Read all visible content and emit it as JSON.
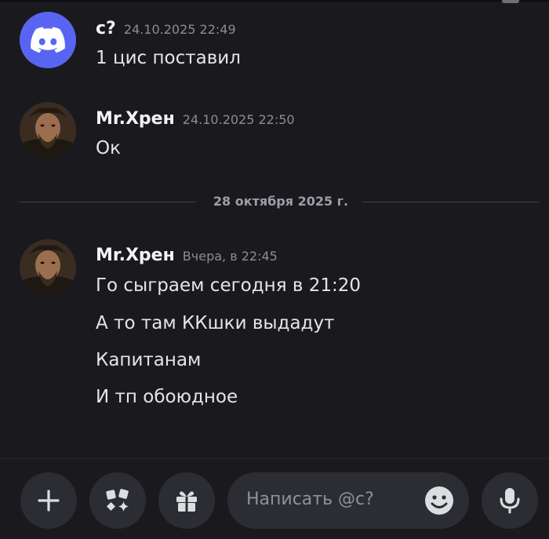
{
  "colors": {
    "background": "#1a1a1e",
    "discord_blurple": "#5865f2",
    "pill": "#2c2d32"
  },
  "messages": [
    {
      "author": "c?",
      "time": "24.10.2025 22:49",
      "avatar": "discord-logo-icon",
      "lines": [
        "1 цис поставил"
      ]
    },
    {
      "author": "Mr.Хрен",
      "time": "24.10.2025 22:50",
      "avatar": "user-portrait",
      "lines": [
        "Ок"
      ]
    }
  ],
  "date_divider": "28 октября 2025 г.",
  "messages_after": [
    {
      "author": "Mr.Хрен",
      "time": "Вчера, в 22:45",
      "avatar": "user-portrait",
      "lines": [
        "Го сыграем сегодня в 21:20",
        "А то там ККшки выдадут",
        "Капитанам",
        "И тп обоюдное"
      ]
    }
  ],
  "composer": {
    "placeholder": "Написать @c?",
    "buttons": [
      "plus-icon",
      "apps-icon",
      "gift-icon",
      "microphone-icon",
      "emoji-icon"
    ]
  }
}
